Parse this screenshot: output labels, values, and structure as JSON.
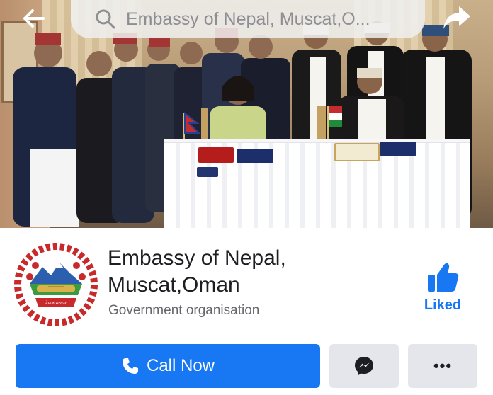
{
  "top_bar": {
    "search_query": "Embassy of Nepal, Muscat,O...",
    "back_icon": "arrow-left-icon",
    "share_icon": "share-arrow-icon",
    "search_icon": "search-icon"
  },
  "page": {
    "name_line1": "Embassy of Nepal,",
    "name_line2": "Muscat,Oman",
    "category": "Government organisation",
    "logo": "nepal-emblem",
    "logo_text": "नेपाल सरकार"
  },
  "like": {
    "label": "Liked",
    "icon": "thumbs-up-icon"
  },
  "actions": {
    "call_label": "Call Now",
    "call_icon": "phone-icon",
    "messenger_icon": "messenger-icon",
    "more_label": "•••"
  },
  "colors": {
    "brand_blue": "#1877f2",
    "secondary_button": "#e4e6eb",
    "text_primary": "#1c1e21",
    "text_secondary": "#65676b"
  }
}
